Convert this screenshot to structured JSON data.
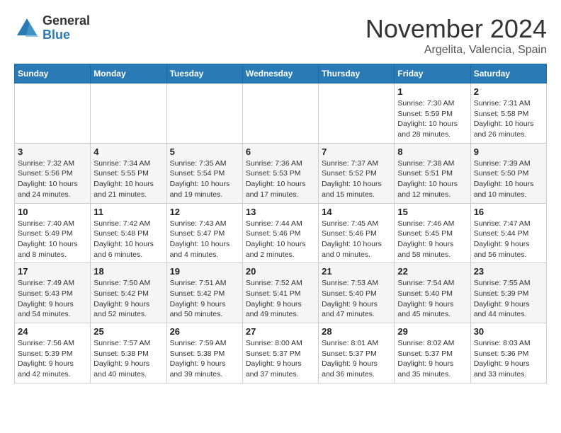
{
  "header": {
    "logo_general": "General",
    "logo_blue": "Blue",
    "month": "November 2024",
    "location": "Argelita, Valencia, Spain"
  },
  "weekdays": [
    "Sunday",
    "Monday",
    "Tuesday",
    "Wednesday",
    "Thursday",
    "Friday",
    "Saturday"
  ],
  "weeks": [
    [
      {
        "day": "",
        "info": ""
      },
      {
        "day": "",
        "info": ""
      },
      {
        "day": "",
        "info": ""
      },
      {
        "day": "",
        "info": ""
      },
      {
        "day": "",
        "info": ""
      },
      {
        "day": "1",
        "info": "Sunrise: 7:30 AM\nSunset: 5:59 PM\nDaylight: 10 hours\nand 28 minutes."
      },
      {
        "day": "2",
        "info": "Sunrise: 7:31 AM\nSunset: 5:58 PM\nDaylight: 10 hours\nand 26 minutes."
      }
    ],
    [
      {
        "day": "3",
        "info": "Sunrise: 7:32 AM\nSunset: 5:56 PM\nDaylight: 10 hours\nand 24 minutes."
      },
      {
        "day": "4",
        "info": "Sunrise: 7:34 AM\nSunset: 5:55 PM\nDaylight: 10 hours\nand 21 minutes."
      },
      {
        "day": "5",
        "info": "Sunrise: 7:35 AM\nSunset: 5:54 PM\nDaylight: 10 hours\nand 19 minutes."
      },
      {
        "day": "6",
        "info": "Sunrise: 7:36 AM\nSunset: 5:53 PM\nDaylight: 10 hours\nand 17 minutes."
      },
      {
        "day": "7",
        "info": "Sunrise: 7:37 AM\nSunset: 5:52 PM\nDaylight: 10 hours\nand 15 minutes."
      },
      {
        "day": "8",
        "info": "Sunrise: 7:38 AM\nSunset: 5:51 PM\nDaylight: 10 hours\nand 12 minutes."
      },
      {
        "day": "9",
        "info": "Sunrise: 7:39 AM\nSunset: 5:50 PM\nDaylight: 10 hours\nand 10 minutes."
      }
    ],
    [
      {
        "day": "10",
        "info": "Sunrise: 7:40 AM\nSunset: 5:49 PM\nDaylight: 10 hours\nand 8 minutes."
      },
      {
        "day": "11",
        "info": "Sunrise: 7:42 AM\nSunset: 5:48 PM\nDaylight: 10 hours\nand 6 minutes."
      },
      {
        "day": "12",
        "info": "Sunrise: 7:43 AM\nSunset: 5:47 PM\nDaylight: 10 hours\nand 4 minutes."
      },
      {
        "day": "13",
        "info": "Sunrise: 7:44 AM\nSunset: 5:46 PM\nDaylight: 10 hours\nand 2 minutes."
      },
      {
        "day": "14",
        "info": "Sunrise: 7:45 AM\nSunset: 5:46 PM\nDaylight: 10 hours\nand 0 minutes."
      },
      {
        "day": "15",
        "info": "Sunrise: 7:46 AM\nSunset: 5:45 PM\nDaylight: 9 hours\nand 58 minutes."
      },
      {
        "day": "16",
        "info": "Sunrise: 7:47 AM\nSunset: 5:44 PM\nDaylight: 9 hours\nand 56 minutes."
      }
    ],
    [
      {
        "day": "17",
        "info": "Sunrise: 7:49 AM\nSunset: 5:43 PM\nDaylight: 9 hours\nand 54 minutes."
      },
      {
        "day": "18",
        "info": "Sunrise: 7:50 AM\nSunset: 5:42 PM\nDaylight: 9 hours\nand 52 minutes."
      },
      {
        "day": "19",
        "info": "Sunrise: 7:51 AM\nSunset: 5:42 PM\nDaylight: 9 hours\nand 50 minutes."
      },
      {
        "day": "20",
        "info": "Sunrise: 7:52 AM\nSunset: 5:41 PM\nDaylight: 9 hours\nand 49 minutes."
      },
      {
        "day": "21",
        "info": "Sunrise: 7:53 AM\nSunset: 5:40 PM\nDaylight: 9 hours\nand 47 minutes."
      },
      {
        "day": "22",
        "info": "Sunrise: 7:54 AM\nSunset: 5:40 PM\nDaylight: 9 hours\nand 45 minutes."
      },
      {
        "day": "23",
        "info": "Sunrise: 7:55 AM\nSunset: 5:39 PM\nDaylight: 9 hours\nand 44 minutes."
      }
    ],
    [
      {
        "day": "24",
        "info": "Sunrise: 7:56 AM\nSunset: 5:39 PM\nDaylight: 9 hours\nand 42 minutes."
      },
      {
        "day": "25",
        "info": "Sunrise: 7:57 AM\nSunset: 5:38 PM\nDaylight: 9 hours\nand 40 minutes."
      },
      {
        "day": "26",
        "info": "Sunrise: 7:59 AM\nSunset: 5:38 PM\nDaylight: 9 hours\nand 39 minutes."
      },
      {
        "day": "27",
        "info": "Sunrise: 8:00 AM\nSunset: 5:37 PM\nDaylight: 9 hours\nand 37 minutes."
      },
      {
        "day": "28",
        "info": "Sunrise: 8:01 AM\nSunset: 5:37 PM\nDaylight: 9 hours\nand 36 minutes."
      },
      {
        "day": "29",
        "info": "Sunrise: 8:02 AM\nSunset: 5:37 PM\nDaylight: 9 hours\nand 35 minutes."
      },
      {
        "day": "30",
        "info": "Sunrise: 8:03 AM\nSunset: 5:36 PM\nDaylight: 9 hours\nand 33 minutes."
      }
    ]
  ]
}
